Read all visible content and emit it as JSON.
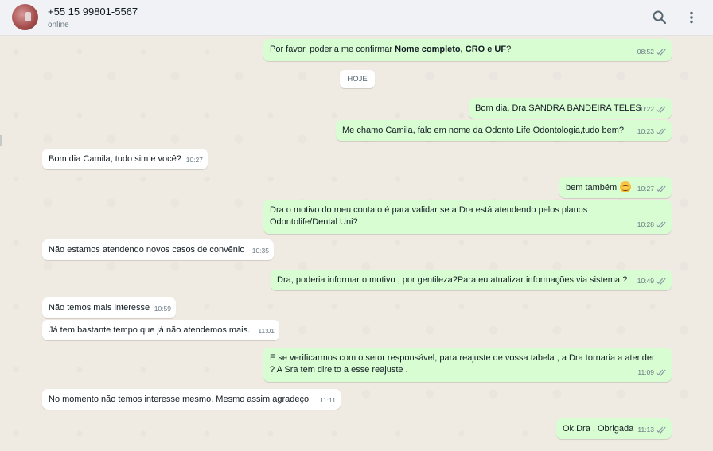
{
  "header": {
    "contact_name": "+55 15 99801-5567",
    "status": "online",
    "icons": [
      "search-icon",
      "menu-dots-icon"
    ]
  },
  "day_badge": "HOJE",
  "messages": [
    {
      "dir": "out",
      "text_before": "Por favor, poderia me confirmar ",
      "bold": "Nome completo, CRO e UF",
      "text_after": "?",
      "time": "08:52"
    },
    {
      "dir": "out",
      "text": "Bom dia, Dra SANDRA BANDEIRA TELES",
      "time": "10:22"
    },
    {
      "dir": "out",
      "text": "Me chamo Camila, falo em nome da Odonto Life Odontologia,tudo bem?",
      "time": "10:23"
    },
    {
      "dir": "in",
      "text": "Bom dia Camila, tudo sim e você?",
      "time": "10:27"
    },
    {
      "dir": "out",
      "text": "bem também",
      "emoji": "smiling-face-emoji",
      "time": "10:27"
    },
    {
      "dir": "out",
      "text": "Dra o motivo do meu contato é para validar se a Dra está atendendo pelos planos Odontolife/Dental Uni?",
      "time": "10:28"
    },
    {
      "dir": "in",
      "text": "Não estamos atendendo novos casos de convênio",
      "time": "10:35"
    },
    {
      "dir": "out",
      "text": "Dra, poderia informar o motivo , por gentileza?Para eu atualizar informações via sistema ?",
      "time": "10:49"
    },
    {
      "dir": "in",
      "text": "Não temos mais interesse",
      "time": "10:59"
    },
    {
      "dir": "in",
      "text": "Já tem bastante tempo que já não atendemos mais.",
      "time": "11:01"
    },
    {
      "dir": "out",
      "text": "E se verificarmos com o setor responsável, para reajuste de vossa tabela , a Dra tornaria a atender ? A Sra tem direito a esse reajuste .",
      "time": "11:09"
    },
    {
      "dir": "in",
      "text": "No momento não temos interesse mesmo. Mesmo assim agradeço",
      "time": "11:11"
    },
    {
      "dir": "out",
      "text": "Ok.Dra . Obrigada",
      "time": "11:13"
    }
  ],
  "colors": {
    "outgoing": "#d9fdd3",
    "incoming": "#ffffff",
    "ticks": "#8696a0",
    "header": "#f0f2f5"
  }
}
